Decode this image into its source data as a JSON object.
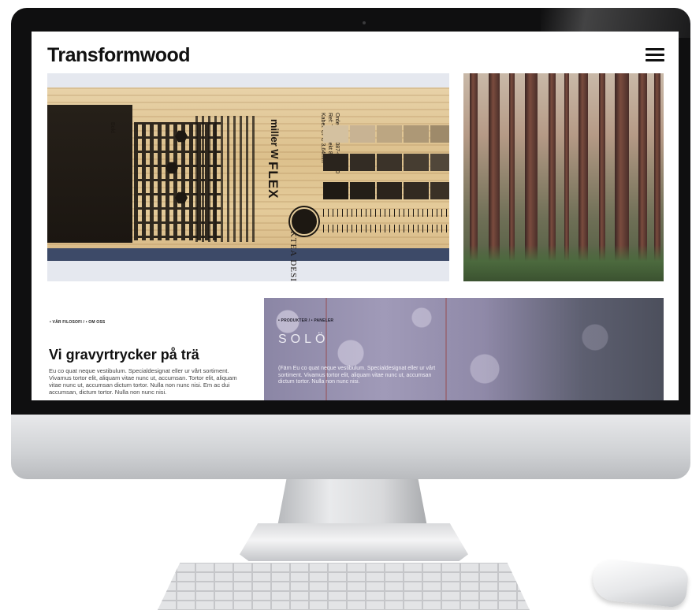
{
  "site": {
    "logo": "Transformwood",
    "menu_icon": "hamburger-menu-icon"
  },
  "hero_product": {
    "brand": "miller W",
    "brand_line2": "FLEX",
    "brand_design": "DOKTEA DESIGN",
    "order_lines": [
      "Order: 0023087-001-000",
      "Ref: Tenprojekt 86",
      "Kabel: CPC 3,64mm"
    ],
    "side_label": "Bold"
  },
  "philosophy": {
    "breadcrumb": "• VÅR FILOSOFI / • OM OSS",
    "title": "Vi gravyrtrycker på trä",
    "body": "Eu co quat neque vestibulum. Specialdesignat eller ur vårt sortiment. Vivamus tortor elit, aliquam vitae nunc ut, accumsan. Tortor elit, aliquam vitae nunc ut, accumsan dictum tortor. Nulla non nunc nisi. Em ac dui accumsan, dictum tortor. Nulla non nunc nisi."
  },
  "product_panel": {
    "breadcrumb": "• PRODUKTER / • PANELER",
    "title": "SOLÖ",
    "body": "(Färn Eu co quat neque vestibulum. Specialdesignat eller ur vårt sortiment. Vivamus tortor elit, aliquam vitae nunc ut, accumsan dictum tortor. Nulla non nunc nisi."
  }
}
